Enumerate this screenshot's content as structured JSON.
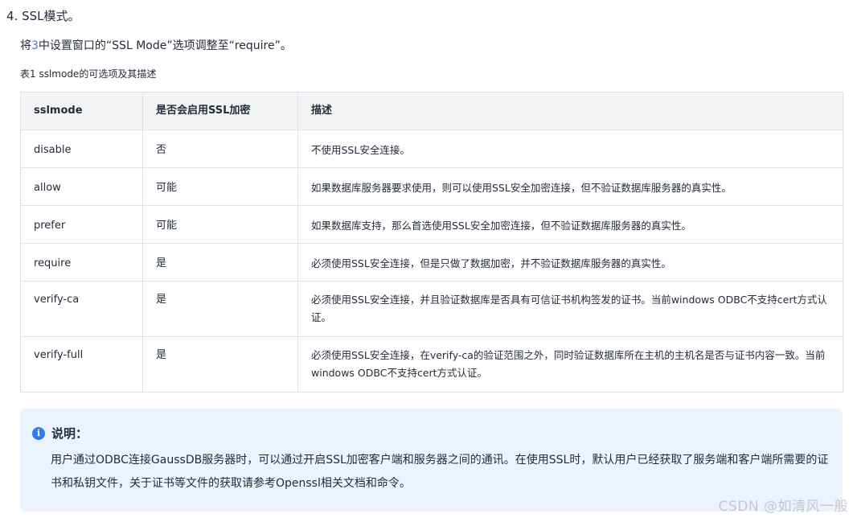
{
  "step": {
    "title": "4. SSL模式。",
    "desc_before": "将",
    "desc_link": "3",
    "desc_after": "中设置窗口的“SSL Mode”选项调整至“require”。"
  },
  "table_caption": "表1 sslmode的可选项及其描述",
  "table": {
    "headers": [
      "sslmode",
      "是否会启用SSL加密",
      "描述"
    ],
    "rows": [
      [
        "disable",
        "否",
        "不使用SSL安全连接。"
      ],
      [
        "allow",
        "可能",
        "如果数据库服务器要求使用，则可以使用SSL安全加密连接，但不验证数据库服务器的真实性。"
      ],
      [
        "prefer",
        "可能",
        "如果数据库支持，那么首选使用SSL安全加密连接，但不验证数据库服务器的真实性。"
      ],
      [
        "require",
        "是",
        "必须使用SSL安全连接，但是只做了数据加密，并不验证数据库服务器的真实性。"
      ],
      [
        "verify-ca",
        "是",
        "必须使用SSL安全连接，并且验证数据库是否具有可信证书机构签发的证书。当前windows ODBC不支持cert方式认证。"
      ],
      [
        "verify-full",
        "是",
        "必须使用SSL安全连接，在verify-ca的验证范围之外，同时验证数据库所在主机的主机名是否与证书内容一致。当前windows ODBC不支持cert方式认证。"
      ]
    ]
  },
  "note": {
    "icon": "info-icon",
    "icon_glyph": "i",
    "title": "说明：",
    "body": "用户通过ODBC连接GaussDB服务器时，可以通过开启SSL加密客户端和服务器之间的通讯。在使用SSL时，默认用户已经获取了服务端和客户端所需要的证书和私钥文件，关于证书等文件的获取请参考Openssl相关文档和命令。"
  },
  "watermark": "CSDN @如清风一般",
  "colors": {
    "link": "#526ecc",
    "header_bg": "#f3f4f6",
    "note_bg": "#eaf3fe",
    "info_icon": "#2f7bf2"
  }
}
